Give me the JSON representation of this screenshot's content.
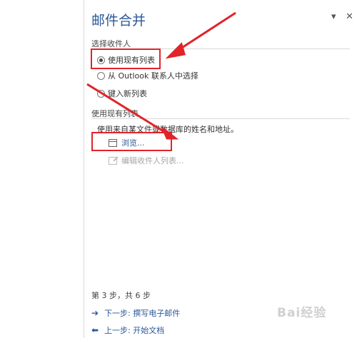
{
  "pane": {
    "title": "邮件合并",
    "down_icon": "dropdown-arrow-icon",
    "close_icon": "close-icon"
  },
  "recipients": {
    "section_label": "选择收件人",
    "options": [
      {
        "label": "使用现有列表",
        "selected": true
      },
      {
        "label": "从 Outlook 联系人中选择",
        "selected": false
      },
      {
        "label": "键入新列表",
        "selected": false
      }
    ]
  },
  "existing_list": {
    "section_label": "使用现有列表",
    "description": "使用来自某文件或数据库的姓名和地址。",
    "browse_label": "浏览...",
    "edit_label": "编辑收件人列表...",
    "browse_icon": "table-icon",
    "edit_icon": "edit-list-icon"
  },
  "footer": {
    "step_text": "第 3 步，共 6 步",
    "next_label": "下一步: 撰写电子邮件",
    "prev_label": "上一步: 开始文档",
    "next_icon": "arrow-right-icon",
    "prev_icon": "arrow-left-icon"
  },
  "annotations": {
    "highlight_color": "#e0242a",
    "accent_color": "#2b579a"
  },
  "watermark": "Bai经验"
}
